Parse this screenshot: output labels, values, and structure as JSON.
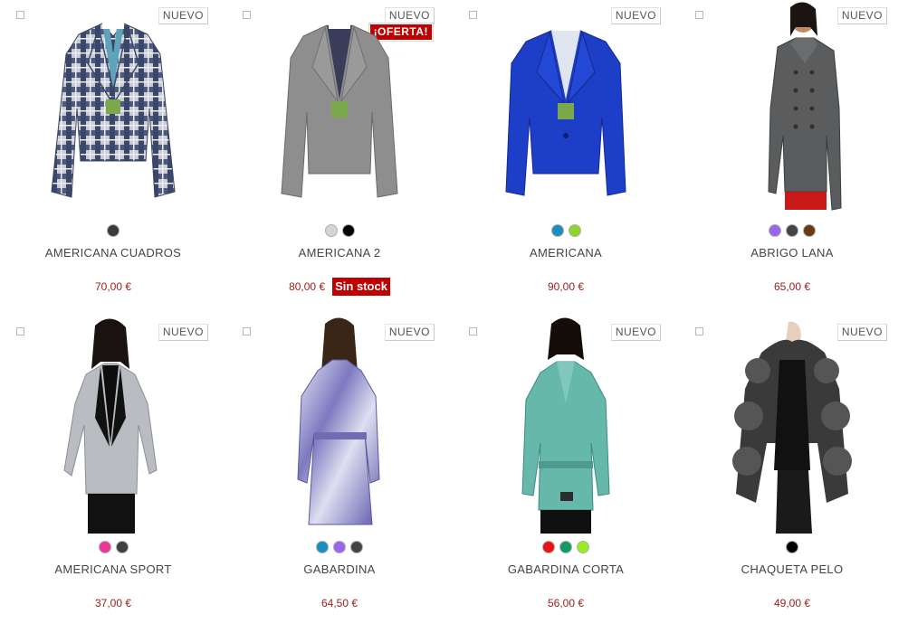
{
  "badges": {
    "new": "NUEVO",
    "offer": "¡OFERTA!",
    "no_stock": "Sin stock"
  },
  "products": [
    {
      "name": "AMERICANA CUADROS",
      "price": "70,00 €",
      "swatches": [
        "#3a3a3a"
      ],
      "new": true,
      "offer": false,
      "no_stock": false,
      "image": "plaid-blazer"
    },
    {
      "name": "AMERICANA 2",
      "price": "80,00 €",
      "swatches": [
        "#d4d4d4",
        "#000000"
      ],
      "new": true,
      "offer": true,
      "no_stock": true,
      "image": "grey-blazer"
    },
    {
      "name": "AMERICANA",
      "price": "90,00 €",
      "swatches": [
        "#1a8fbf",
        "#8ed42a"
      ],
      "new": true,
      "offer": false,
      "no_stock": false,
      "image": "blue-blazer"
    },
    {
      "name": "ABRIGO LANA",
      "price": "65,00 €",
      "swatches": [
        "#9966ee",
        "#444444",
        "#6b3a12"
      ],
      "new": true,
      "offer": false,
      "no_stock": false,
      "image": "wool-coat"
    },
    {
      "name": "AMERICANA SPORT",
      "price": "37,00 €",
      "swatches": [
        "#ee3399",
        "#3f3f3f"
      ],
      "new": true,
      "offer": false,
      "no_stock": false,
      "image": "sport-blazer"
    },
    {
      "name": "GABARDINA",
      "price": "64,50 €",
      "swatches": [
        "#1a8fbf",
        "#9966ee",
        "#444444"
      ],
      "new": true,
      "offer": false,
      "no_stock": false,
      "image": "trench-coat-purple"
    },
    {
      "name": "GABARDINA CORTA",
      "price": "56,00 €",
      "swatches": [
        "#ee1111",
        "#119966",
        "#99ee22"
      ],
      "new": true,
      "offer": false,
      "no_stock": false,
      "image": "trench-coat-teal"
    },
    {
      "name": "CHAQUETA PELO",
      "price": "49,00 €",
      "swatches": [
        "#000000"
      ],
      "new": true,
      "offer": false,
      "no_stock": false,
      "image": "fur-jacket"
    }
  ]
}
